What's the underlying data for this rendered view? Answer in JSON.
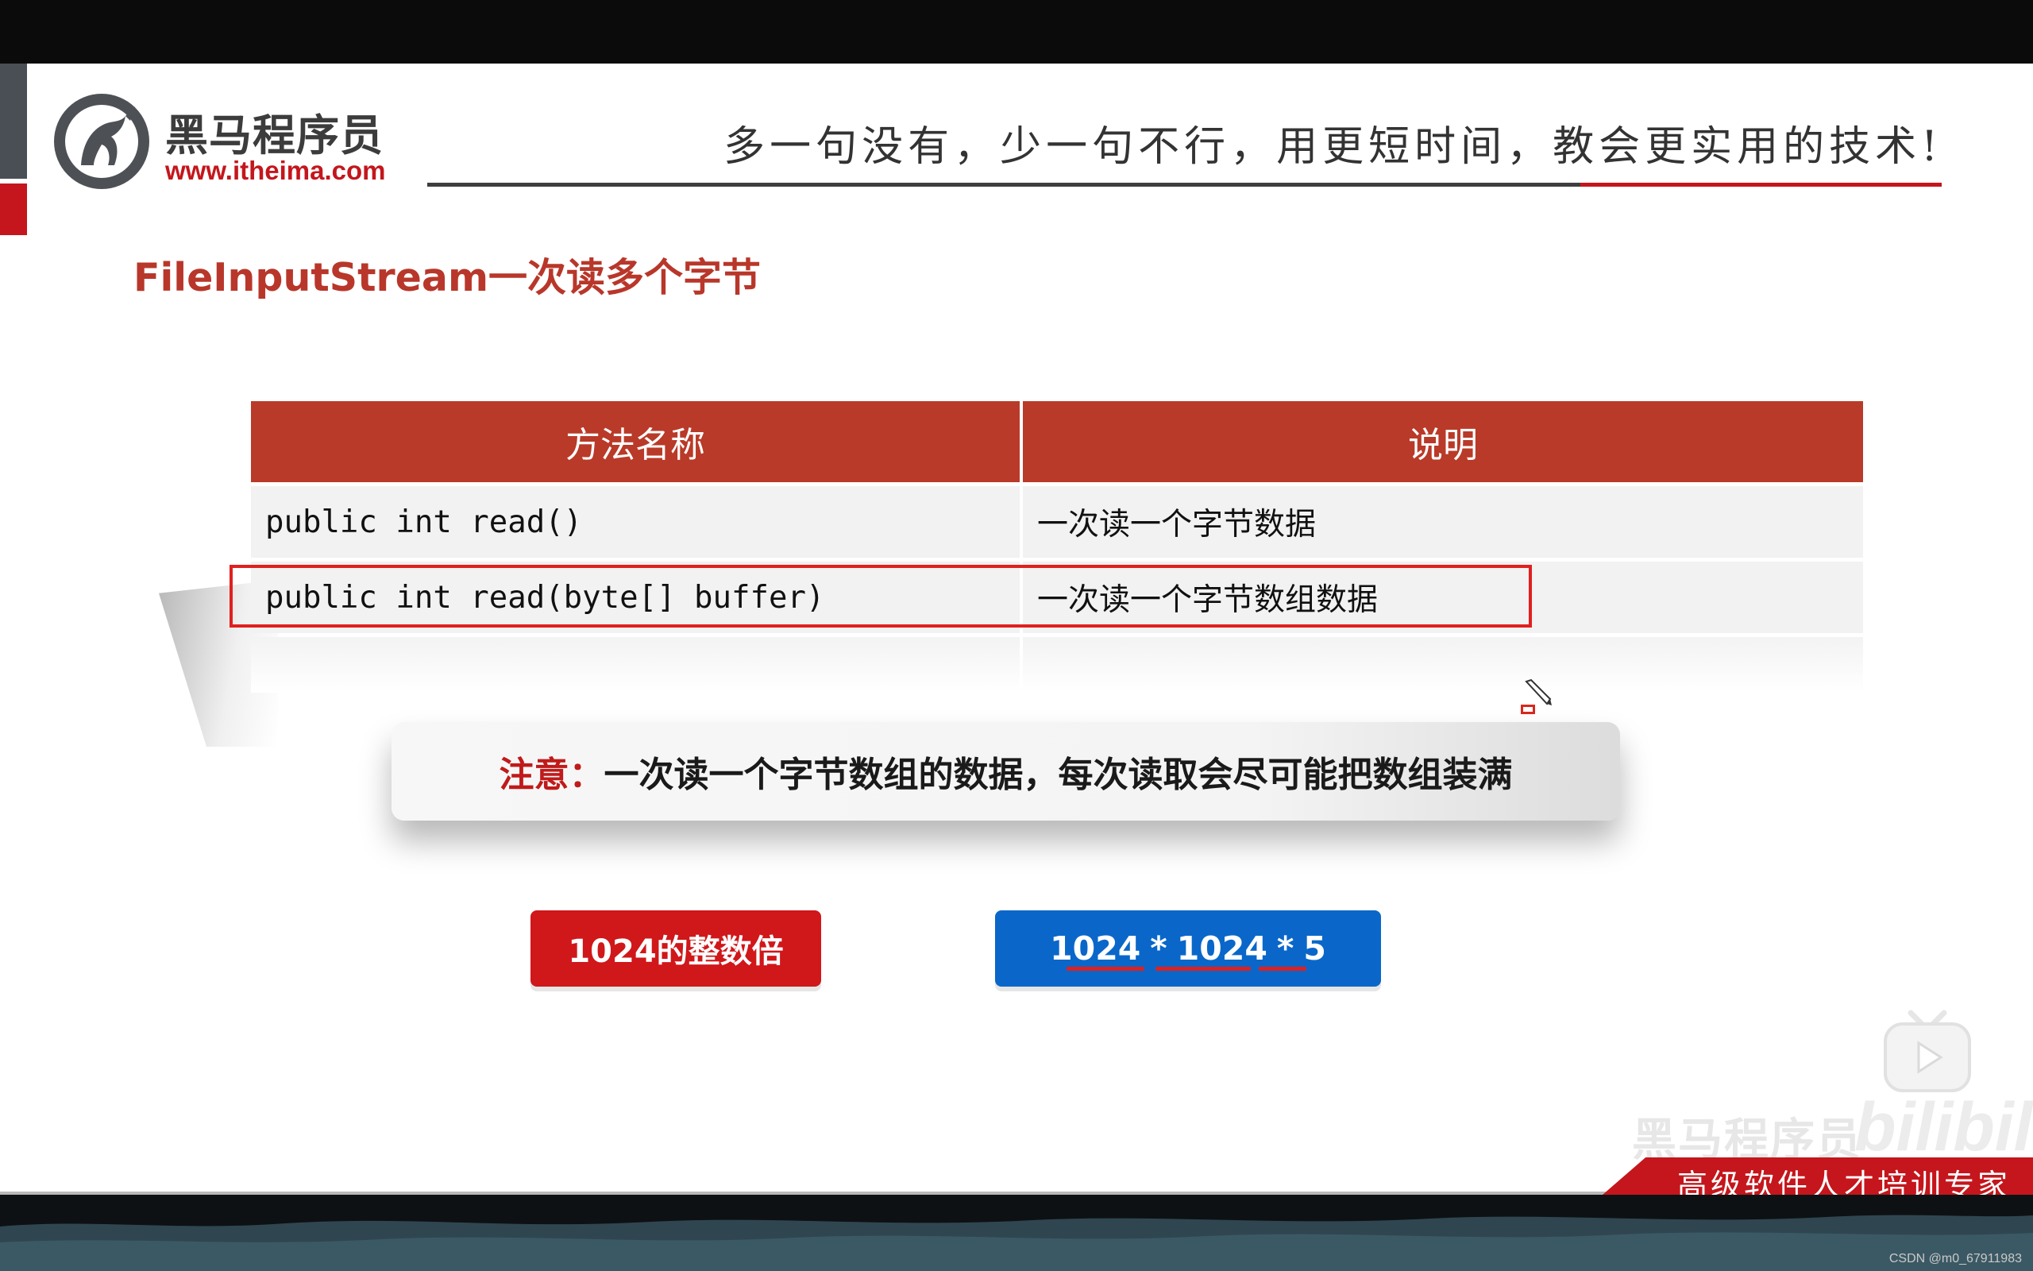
{
  "header": {
    "logo_name": "黑马程序员",
    "logo_url": "www.itheima.com",
    "slogan": "多一句没有，少一句不行，用更短时间，教会更实用的技术!"
  },
  "slide": {
    "title": "FileInputStream一次读多个字节"
  },
  "table": {
    "headers": [
      "方法名称",
      "说明"
    ],
    "rows": [
      [
        "public int read()",
        "一次读一个字节数据"
      ],
      [
        "public int read(byte[] buffer)",
        "一次读一个字节数组数据"
      ]
    ]
  },
  "note": {
    "label": "注意：",
    "text": "一次读一个字节数组的数据，每次读取会尽可能把数组装满"
  },
  "badges": {
    "left": "1024的整数倍",
    "right_parts": [
      "1024",
      "*",
      "1024",
      "*",
      "5"
    ]
  },
  "watermark": {
    "channel": "黑马程序员",
    "brand": "bilibili"
  },
  "footer": {
    "tagline": "高级软件人才培训专家",
    "credit": "CSDN @m0_67911983"
  },
  "colors": {
    "accent_red": "#c4161c",
    "table_header": "#b93a28",
    "badge_blue": "#0a67c9"
  }
}
